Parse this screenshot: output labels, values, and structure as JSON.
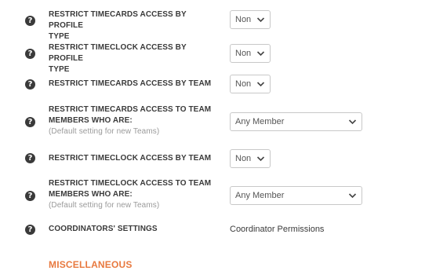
{
  "settings": [
    {
      "label_line1": "RESTRICT TIMECARDS ACCESS BY PROFILE",
      "label_line2": "TYPE",
      "sublabel": "",
      "value": "Non"
    },
    {
      "label_line1": "RESTRICT TIMECLOCK ACCESS BY PROFILE",
      "label_line2": "TYPE",
      "sublabel": "",
      "value": "Non"
    },
    {
      "label_line1": "RESTRICT TIMECARDS ACCESS BY TEAM",
      "label_line2": "",
      "sublabel": "",
      "value": "Non"
    },
    {
      "label_line1": "RESTRICT TIMECARDS ACCESS TO TEAM",
      "label_line2": "MEMBERS WHO ARE:",
      "sublabel": "(Default setting for new Teams)",
      "value": "Any Member"
    },
    {
      "label_line1": "RESTRICT TIMECLOCK ACCESS BY TEAM",
      "label_line2": "",
      "sublabel": "",
      "value": "Non"
    },
    {
      "label_line1": "RESTRICT TIMECLOCK ACCESS TO TEAM",
      "label_line2": "MEMBERS WHO ARE:",
      "sublabel": "(Default setting for new Teams)",
      "value": "Any Member"
    },
    {
      "label_line1": "COORDINATORS' SETTINGS",
      "label_line2": "",
      "sublabel": "",
      "value": "Coordinator Permissions"
    }
  ],
  "help_icon_glyph": "?",
  "section_title": "MISCELLANEOUS",
  "colors": {
    "accent": "#e8793f",
    "text": "#3a3a3a",
    "muted": "#9a9a9a",
    "border": "#c8c8c8"
  }
}
